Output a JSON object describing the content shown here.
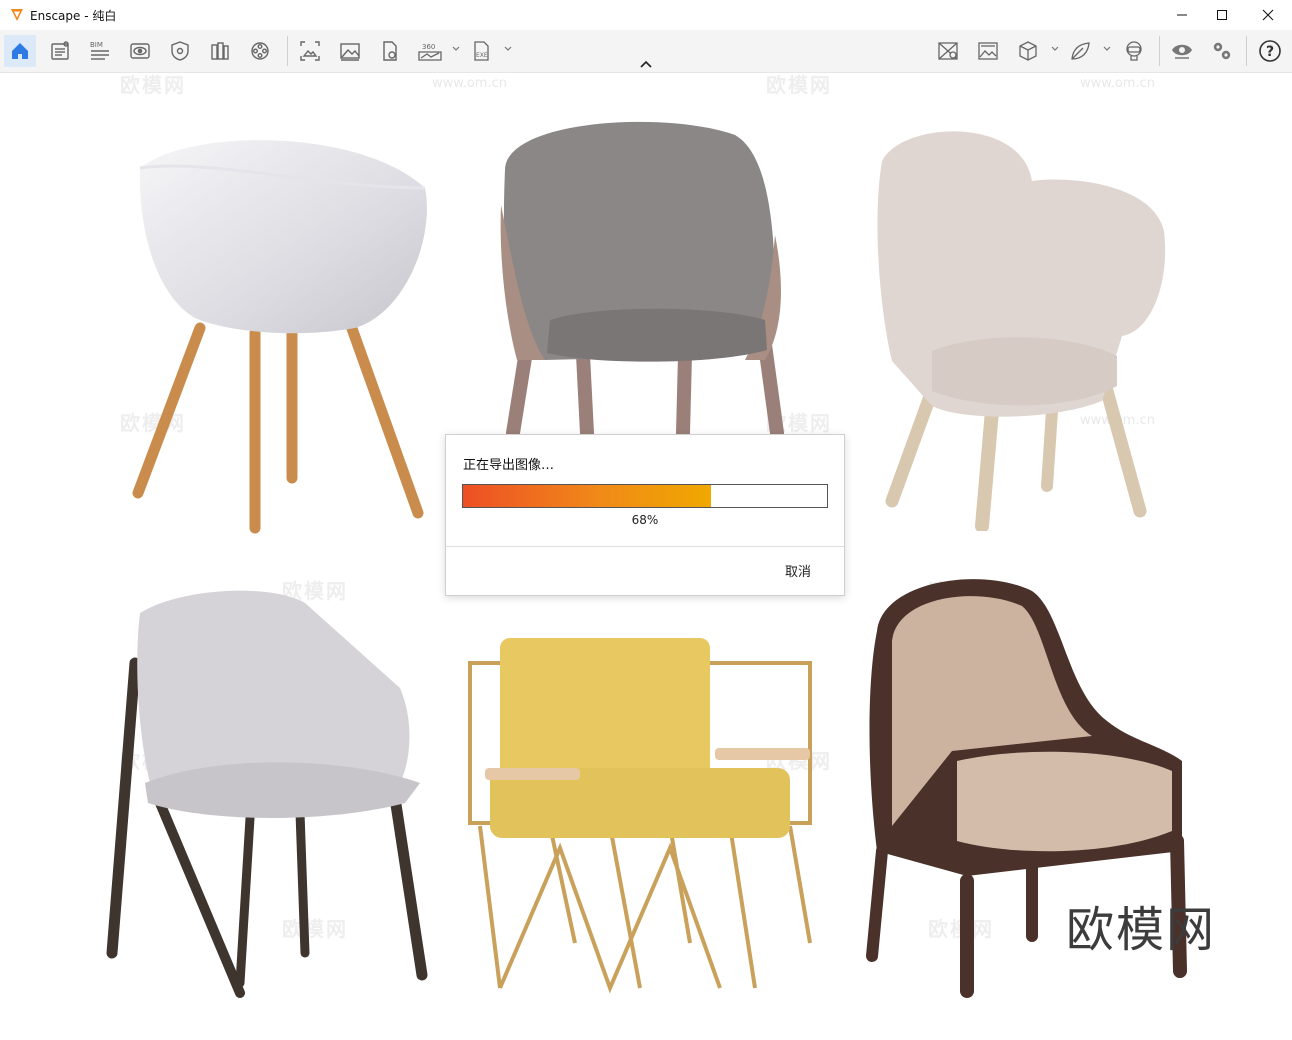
{
  "window": {
    "title": "Enscape - 纯白",
    "buttons": [
      "minimize-icon",
      "maximize-icon",
      "close-icon"
    ]
  },
  "toolbar": {
    "bim_label": "BIM",
    "pano_label": "360",
    "exe_label": "EXE",
    "left_icons": [
      "home-icon",
      "document-icon",
      "bim-icon",
      "eye-view-icon",
      "shield-icon",
      "books-icon",
      "film-reel-icon",
      "capture-frame-icon",
      "image-icon",
      "file-refresh-icon",
      "panorama-360-icon",
      "exe-file-icon"
    ],
    "right_icons": [
      "image-compare-icon",
      "image-settings-icon",
      "cube-icon",
      "leaf-icon",
      "vr-headset-icon",
      "visibility-icon",
      "settings-gears-icon",
      "help-icon"
    ],
    "accent_color": "#2d7be5"
  },
  "viewport": {
    "watermark_text": "欧模网",
    "watermark_url": "www.om.cn",
    "corner_brand": "欧模网",
    "chairs": [
      {
        "name": "white-shell-chair"
      },
      {
        "name": "gray-leather-chair"
      },
      {
        "name": "beige-fabric-armchair"
      },
      {
        "name": "gray-fabric-chair"
      },
      {
        "name": "yellow-gold-armchair"
      },
      {
        "name": "dark-wood-lounge-chair"
      }
    ]
  },
  "dialog": {
    "title": "正在导出图像…",
    "progress": 0.68,
    "progress_label": "68%",
    "cancel_label": "取消"
  }
}
